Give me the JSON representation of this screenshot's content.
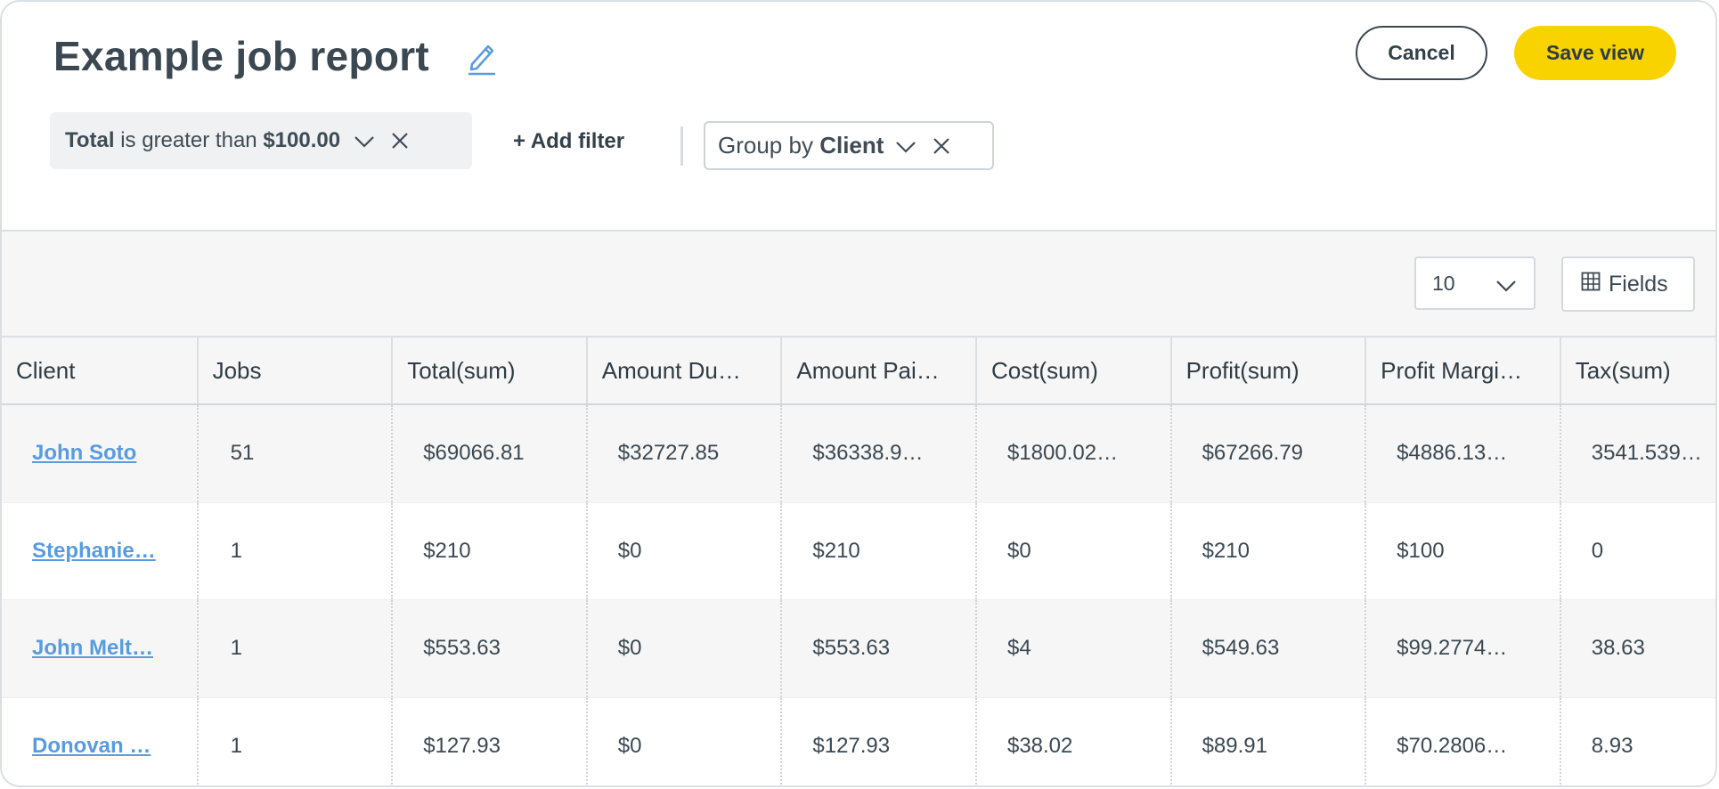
{
  "header": {
    "title": "Example job report",
    "cancel_label": "Cancel",
    "save_label": "Save view"
  },
  "filters": {
    "active": {
      "field": "Total",
      "operator": "is greater than",
      "value": "$100.00"
    },
    "add_label": "+ Add filter",
    "group": {
      "prefix": "Group by",
      "field": "Client"
    }
  },
  "toolbar": {
    "page_size": "10",
    "fields_label": "Fields"
  },
  "table": {
    "columns": [
      "Client",
      "Jobs",
      "Total(sum)",
      "Amount Du…",
      "Amount Pai…",
      "Cost(sum)",
      "Profit(sum)",
      "Profit Margi…",
      "Tax(sum)"
    ],
    "rows": [
      [
        "John Soto",
        "51",
        "$69066.81",
        "$32727.85",
        "$36338.9…",
        "$1800.02…",
        "$67266.79",
        "$4886.13…",
        "3541.539…"
      ],
      [
        "Stephanie…",
        "1",
        "$210",
        "$0",
        "$210",
        "$0",
        "$210",
        "$100",
        "0"
      ],
      [
        "John Melt…",
        "1",
        "$553.63",
        "$0",
        "$553.63",
        "$4",
        "$549.63",
        "$99.2774…",
        "38.63"
      ],
      [
        "Donovan …",
        "1",
        "$127.93",
        "$0",
        "$127.93",
        "$38.02",
        "$89.91",
        "$70.2806…",
        "8.93"
      ]
    ]
  },
  "colors": {
    "accent_yellow": "#f8d300",
    "link_blue": "#5a9be0",
    "text_dark": "#33414a",
    "row_shade": "#f6f6f6"
  },
  "icons": {
    "edit": "pencil-icon",
    "dropdown": "chevron-down-icon",
    "remove": "close-icon",
    "fields": "grid-icon"
  }
}
